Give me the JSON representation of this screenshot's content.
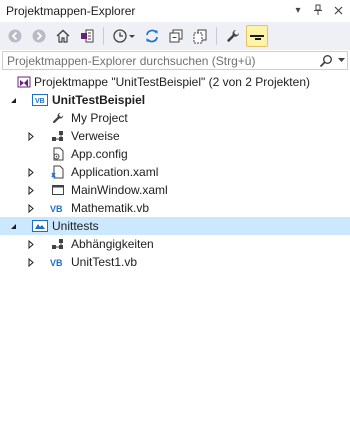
{
  "window": {
    "title": "Projektmappen-Explorer"
  },
  "search": {
    "placeholder": "Projektmappen-Explorer durchsuchen (Strg+ü)"
  },
  "tree": {
    "solution": "Projektmappe \"UnitTestBeispiel\" (2 von 2 Projekten)",
    "project1": {
      "name": "UnitTestBeispiel",
      "items": [
        "My Project",
        "Verweise",
        "App.config",
        "Application.xaml",
        "MainWindow.xaml",
        "Mathematik.vb"
      ]
    },
    "project2": {
      "name": "Unittests",
      "items": [
        "Abhängigkeiten",
        "UnitTest1.vb"
      ]
    }
  },
  "colors": {
    "selection": "#cce8ff",
    "toolbar": "#eef0f6",
    "accent": "#1e6fc8"
  }
}
